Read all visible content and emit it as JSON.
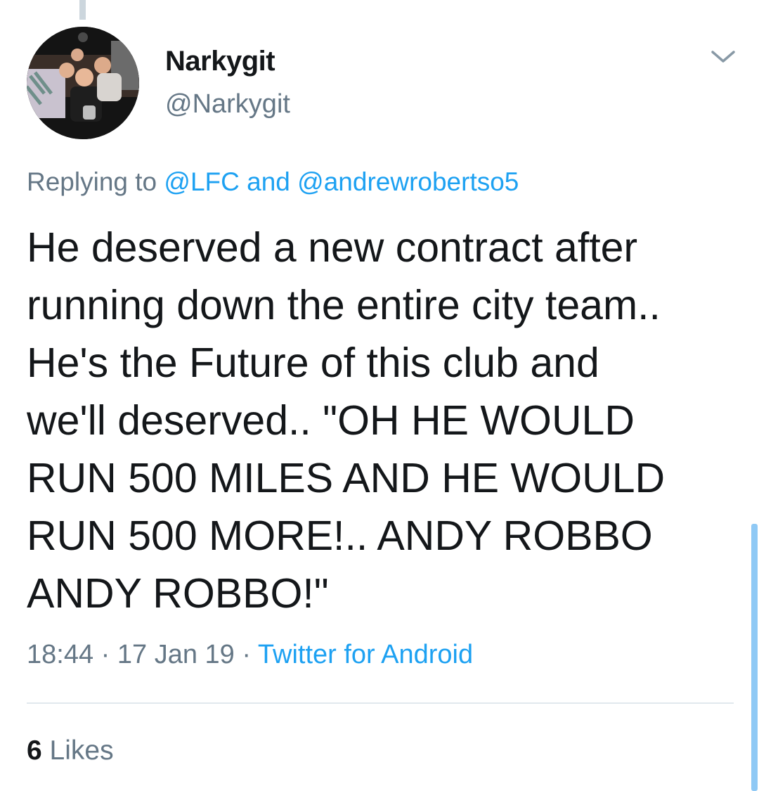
{
  "user": {
    "display_name": "Narkygit",
    "handle": "@Narkygit"
  },
  "reply": {
    "prefix": "Replying to ",
    "mention1": "@LFC",
    "joiner": " and ",
    "mention2": "@andrewrobertso5"
  },
  "tweet": {
    "text": "He deserved a new contract after\nrunning down the entire city team..\nHe's the Future of this club and\nwe'll deserved.. \"OH HE WOULD\nRUN 500 MILES AND HE WOULD\nRUN 500 MORE!.. ANDY ROBBO\nANDY ROBBO!\""
  },
  "meta": {
    "time": "18:44",
    "separator": " · ",
    "date": "17 Jan 19",
    "source": "Twitter for Android"
  },
  "likes": {
    "count": "6",
    "label": " Likes"
  },
  "icons": {
    "menu": "chevron-down-icon",
    "avatar": "profile-photo"
  },
  "colors": {
    "link": "#1da1f2",
    "secondary_text": "#657786",
    "primary_text": "#14171a"
  }
}
